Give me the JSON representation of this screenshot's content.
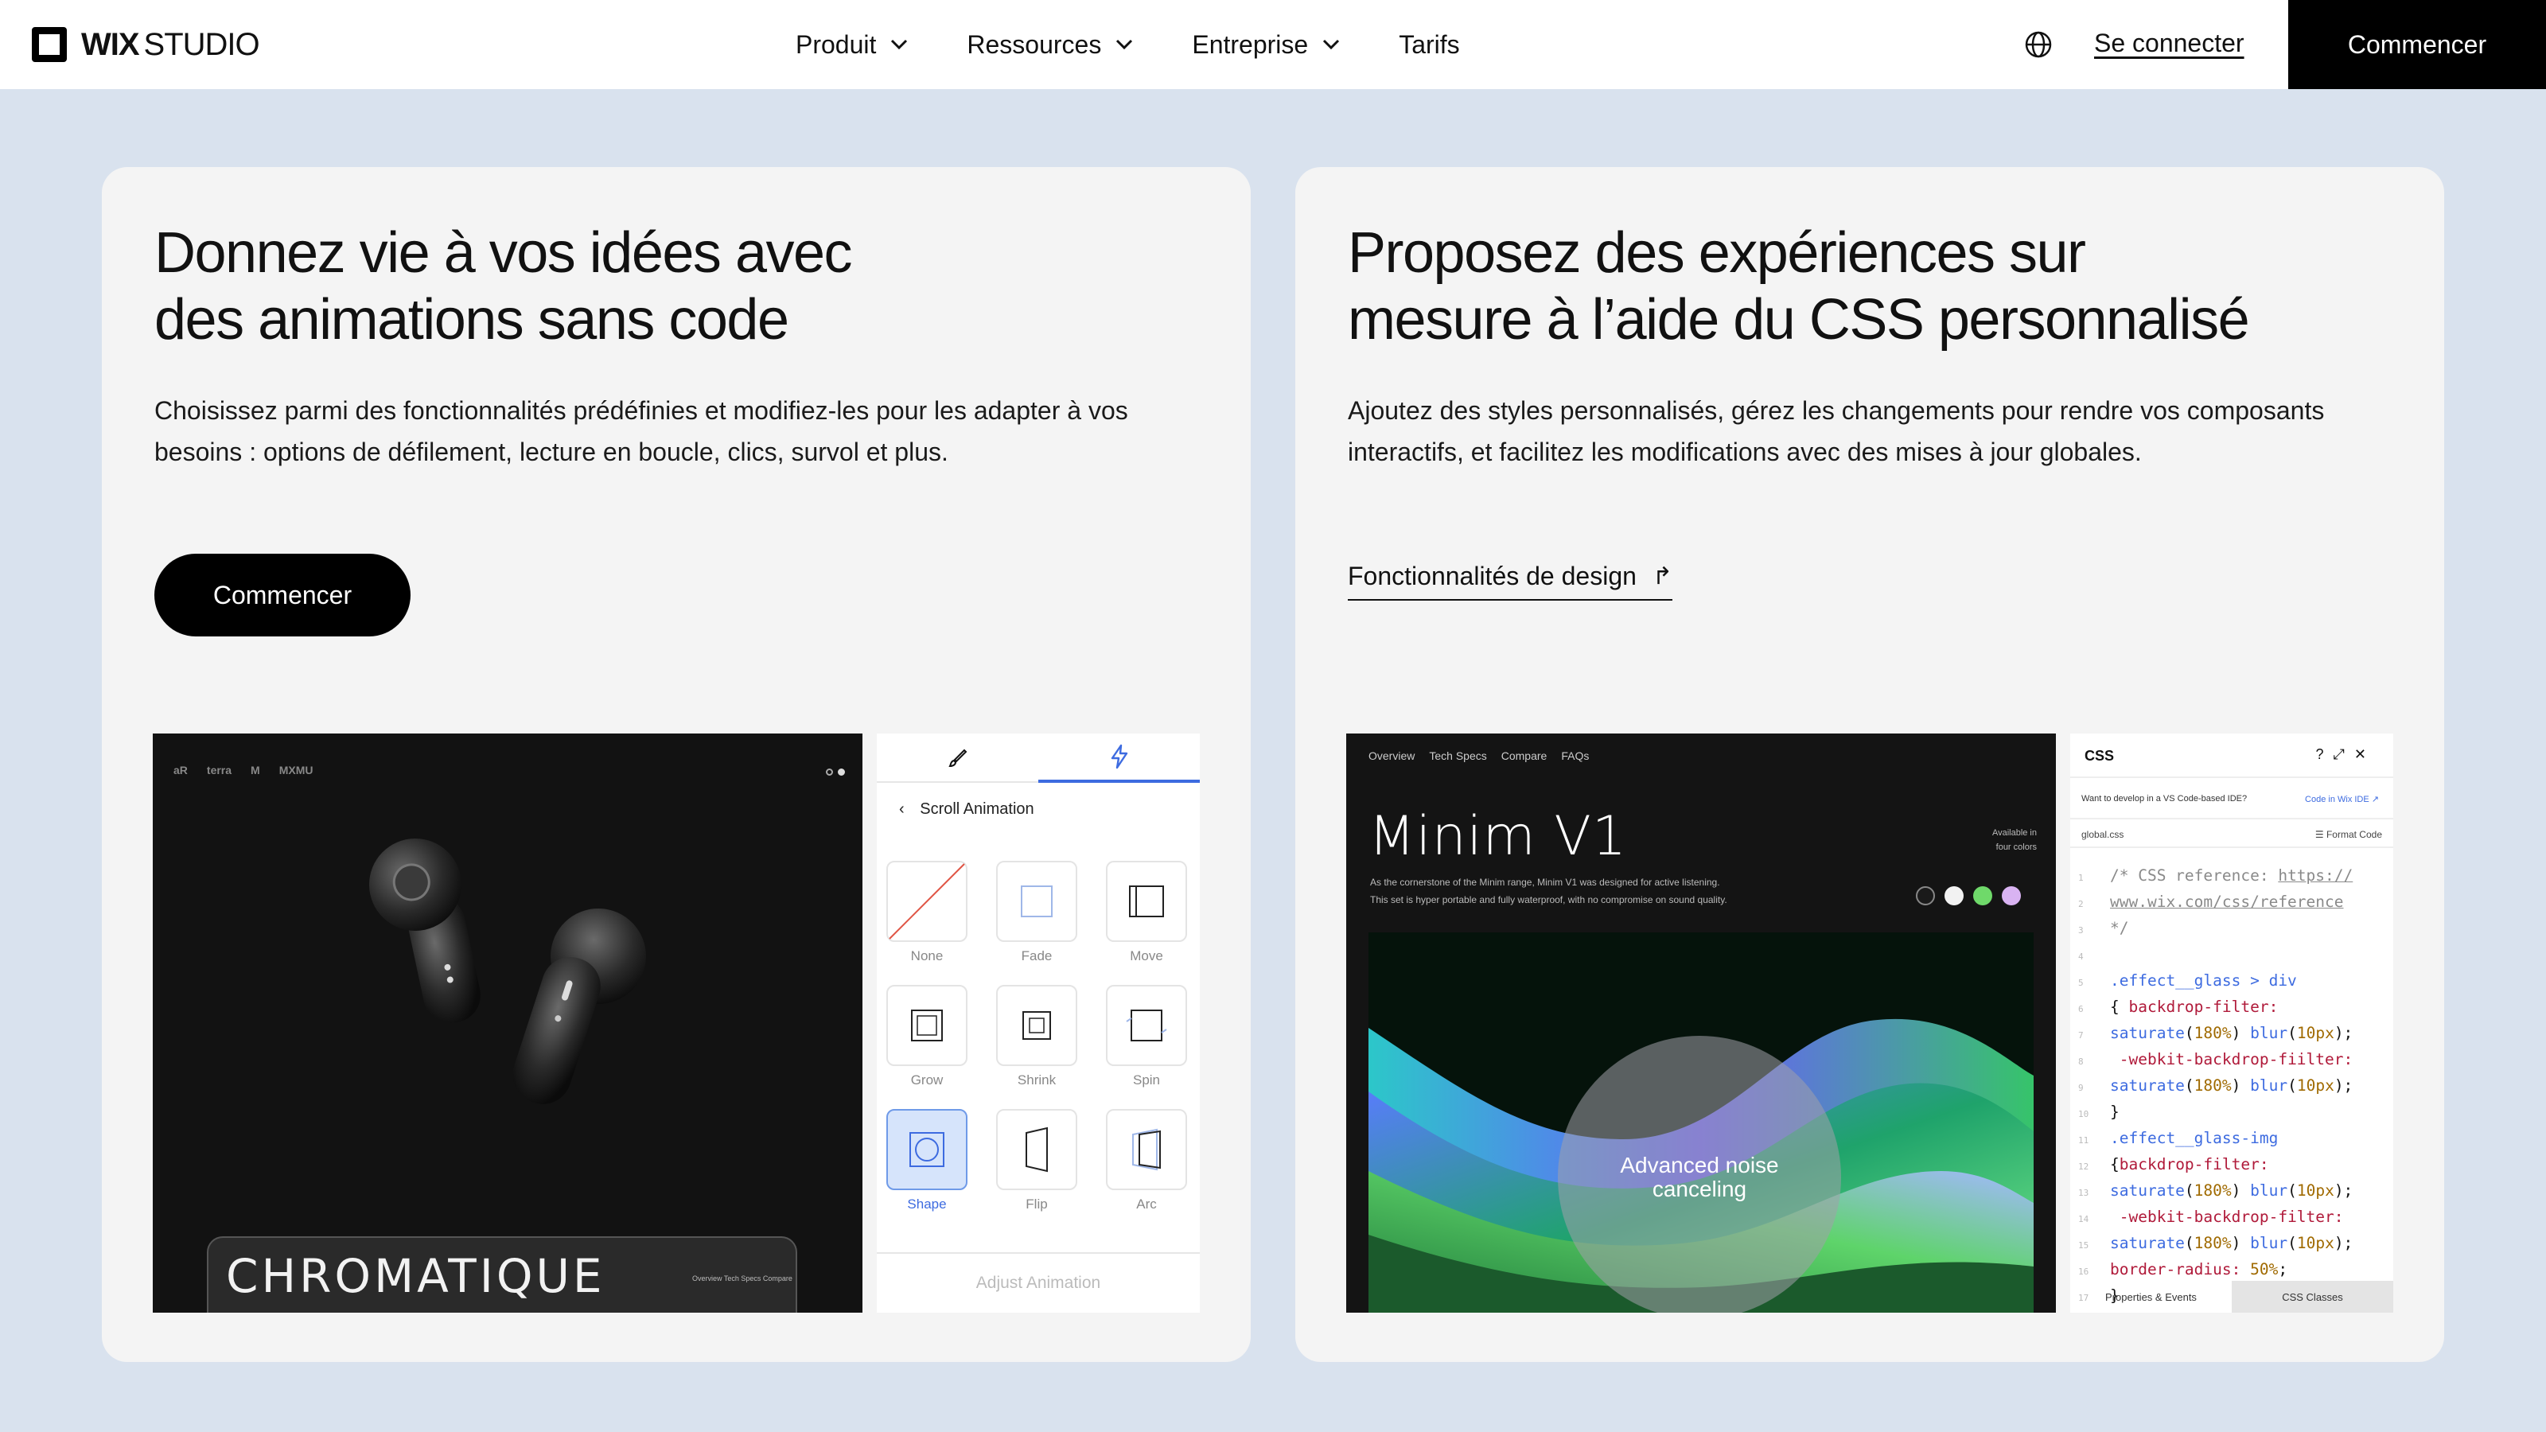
{
  "header": {
    "logo_wix": "WIX",
    "logo_studio": "STUDIO",
    "nav": [
      {
        "label": "Produit",
        "has_dropdown": true
      },
      {
        "label": "Ressources",
        "has_dropdown": true
      },
      {
        "label": "Entreprise",
        "has_dropdown": true
      },
      {
        "label": "Tarifs",
        "has_dropdown": false
      }
    ],
    "login": "Se connecter",
    "cta": "Commencer"
  },
  "left_card": {
    "title_line1": "Donnez vie à vos idées avec",
    "title_line2": "des animations sans code",
    "description": "Choisissez parmi des fonctionnalités prédéfinies et modifiez-les pour les adapter à vos besoins : options de défilement, lecture en boucle, clics, survol et plus.",
    "button": "Commencer",
    "preview": {
      "brand_logos": [
        "aR",
        "terra",
        "M",
        "MXMU"
      ],
      "product_title": "CHROMATIQUE",
      "product_nav": "Overview   Tech Specs   Compare"
    },
    "animation_panel": {
      "back_label": "Scroll Animation",
      "options": [
        "None",
        "Fade",
        "Move",
        "Grow",
        "Shrink",
        "Spin",
        "Shape",
        "Flip",
        "Arc"
      ],
      "selected": "Shape",
      "adjust_label": "Adjust Animation"
    }
  },
  "right_card": {
    "title_line1": "Proposez des expériences sur",
    "title_line2": "mesure à l’aide du CSS personnalisé",
    "description": "Ajoutez des styles personnalisés, gérez les changements pour rendre vos composants interactifs, et facilitez les modifications avec des mises à jour globales.",
    "link": "Fonctionnalités de design",
    "preview": {
      "nav": [
        "Overview",
        "Tech Specs",
        "Compare",
        "FAQs"
      ],
      "product_title": "Minim V1",
      "subtitle_line1": "As the cornerstone of the Minim range, Minim V1 was designed for active listening.",
      "subtitle_line2": "This set is hyper portable and fully waterproof, with no compromise on sound quality.",
      "availability_line1": "Available in",
      "availability_line2": "four colors",
      "swatch_colors": [
        "#1a1a1a",
        "#f2f2f2",
        "#6fd96a",
        "#d9b3f2"
      ],
      "hero_label_line1": "Advanced noise",
      "hero_label_line2": "canceling"
    },
    "css_panel": {
      "title": "CSS",
      "ide_question": "Want to develop in a VS Code-based IDE?",
      "ide_link": "Code in Wix IDE",
      "file": "global.css",
      "format": "Format Code",
      "tab_properties": "Properties & Events",
      "tab_classes": "CSS Classes"
    }
  },
  "colors": {
    "page_bg": "#d9e2ee",
    "card_bg": "#f4f4f4",
    "accent_blue": "#3d6be0",
    "black": "#000000"
  }
}
